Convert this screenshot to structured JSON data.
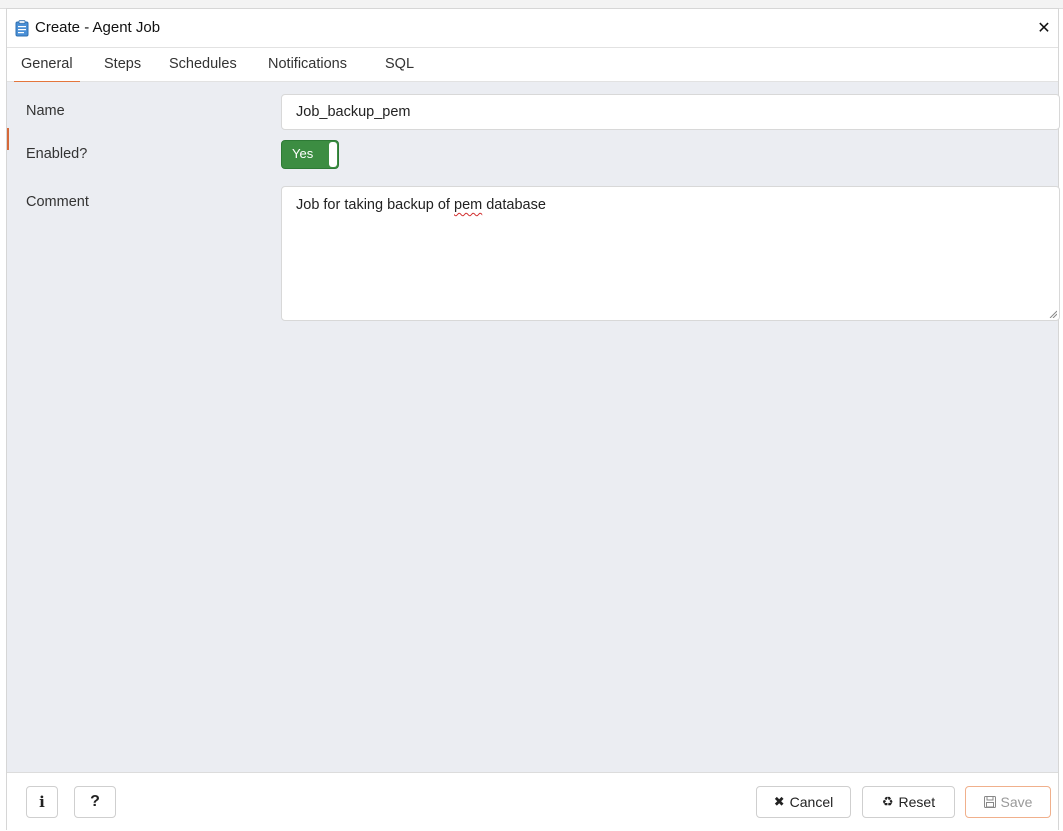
{
  "dialog": {
    "title": "Create - Agent Job",
    "title_icon": "clipboard-icon",
    "close_icon": "close-icon"
  },
  "tabs": [
    {
      "label": "General",
      "active": true
    },
    {
      "label": "Steps",
      "active": false
    },
    {
      "label": "Schedules",
      "active": false
    },
    {
      "label": "Notifications",
      "active": false
    },
    {
      "label": "SQL",
      "active": false
    }
  ],
  "form": {
    "name_label": "Name",
    "name_value": "Job_backup_pem",
    "enabled_label": "Enabled?",
    "enabled_value": "Yes",
    "comment_label": "Comment",
    "comment_before": "Job for taking backup of ",
    "comment_misspelled": "pem",
    "comment_after": " database"
  },
  "footer": {
    "info_label": "i",
    "help_label": "?",
    "cancel_label": "Cancel",
    "cancel_icon": "times-icon",
    "reset_label": "Reset",
    "reset_icon": "recycle-icon",
    "save_label": "Save",
    "save_icon": "floppy-disk-icon"
  },
  "colors": {
    "accent": "#e4753c",
    "toggle_on": "#3c8d42",
    "content_bg": "#ebedf2"
  }
}
